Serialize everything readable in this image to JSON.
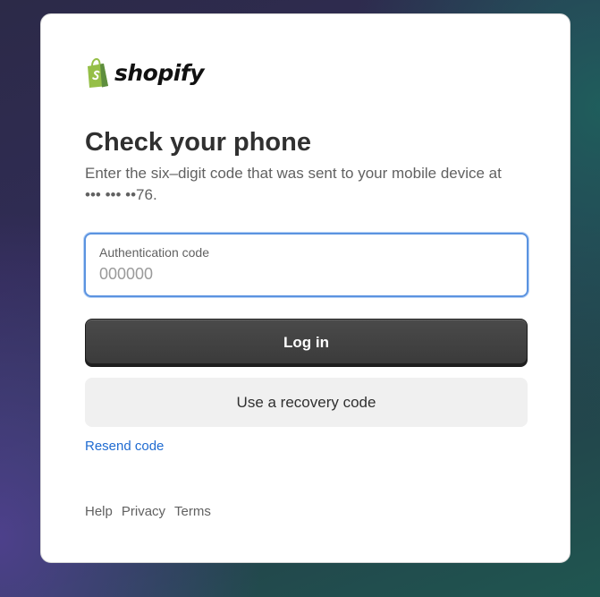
{
  "brand": {
    "name": "shopify",
    "logo_icon": "shopify-bag-icon",
    "color": "#95bf47"
  },
  "heading": "Check your phone",
  "description": "Enter the six–digit code that was sent to your mobile device at ••• ••• ••76.",
  "auth_field": {
    "label": "Authentication code",
    "placeholder": "000000",
    "value": ""
  },
  "buttons": {
    "login": "Log in",
    "recovery": "Use a recovery code"
  },
  "resend_link": "Resend code",
  "footer": {
    "links": [
      "Help",
      "Privacy",
      "Terms"
    ]
  },
  "colors": {
    "primary_button": "#3f3f3f",
    "link": "#1f6bd1",
    "focus_ring": "#5b93e0"
  }
}
